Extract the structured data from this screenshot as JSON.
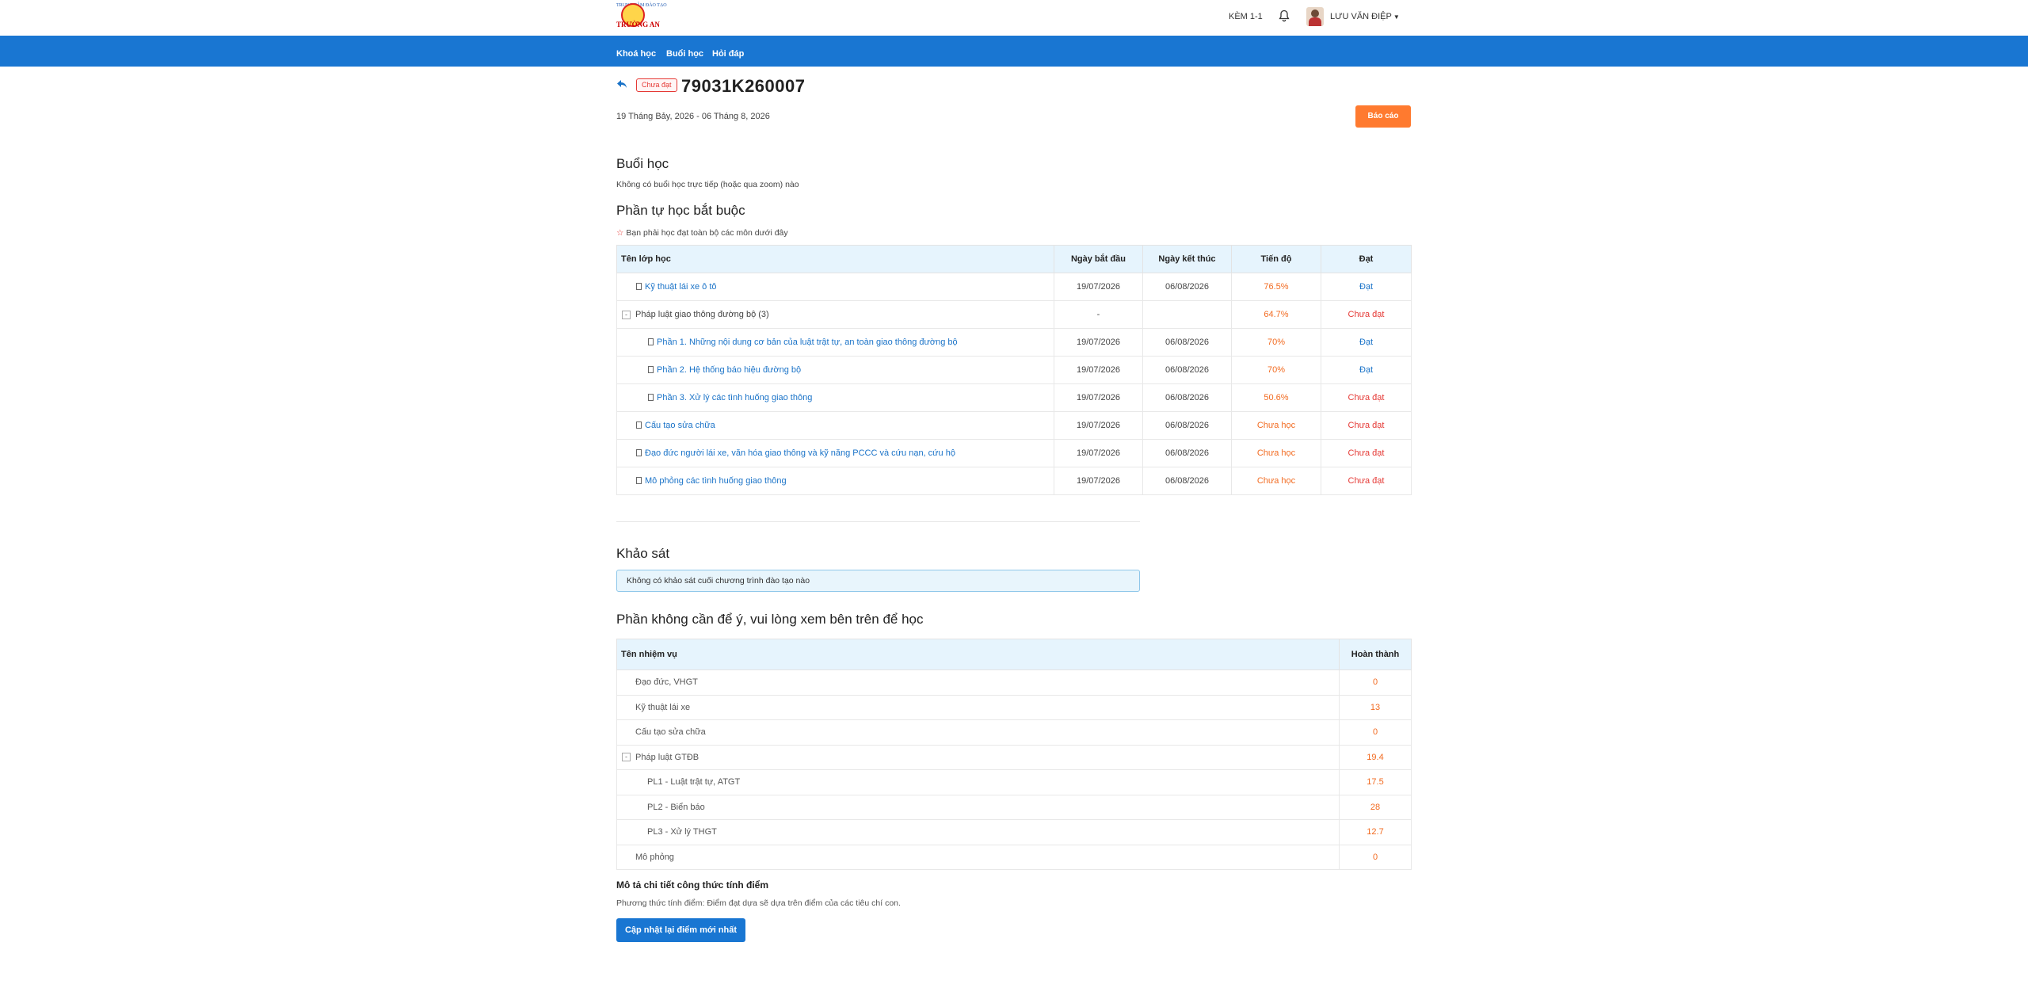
{
  "header": {
    "logo_text": "TRƯỜNG AN",
    "logo_arc_text": "TRUNG TÂM ĐÀO TẠO",
    "kem_label": "KÈM 1-1",
    "user_name": "LƯU VĂN ĐIỆP"
  },
  "nav": {
    "items": [
      "Khoá học",
      "Buổi học",
      "Hỏi đáp"
    ]
  },
  "course": {
    "status_badge": "Chưa đạt",
    "code": "79031K260007",
    "date_range": "19 Tháng Bảy, 2026 - 06 Tháng 8, 2026",
    "report_button": "Báo cáo"
  },
  "sessions": {
    "title": "Buổi học",
    "empty_text": "Không có buổi học trực tiếp (hoặc qua zoom) nào"
  },
  "required": {
    "title": "Phần tự học bắt buộc",
    "note": "Bạn phải học đạt toàn bộ các môn dưới đây",
    "columns": [
      "Tên lớp học",
      "Ngày bắt đầu",
      "Ngày kết thúc",
      "Tiến độ",
      "Đạt"
    ],
    "rows": [
      {
        "name": "Kỹ thuật lái xe ô tô",
        "start": "19/07/2026",
        "end": "06/08/2026",
        "progress": "76.5%",
        "result": "Đạt"
      },
      {
        "name": "Pháp luật giao thông đường bộ",
        "count": "(3)",
        "start": "-",
        "end": "",
        "progress": "64.7%",
        "result": "Chưa đạt"
      },
      {
        "name": "Phần 1. Những nội dung cơ bản của luật trật tự, an toàn giao thông đường bộ",
        "start": "19/07/2026",
        "end": "06/08/2026",
        "progress": "70%",
        "result": "Đạt"
      },
      {
        "name": "Phần 2. Hệ thống báo hiệu đường bộ",
        "start": "19/07/2026",
        "end": "06/08/2026",
        "progress": "70%",
        "result": "Đạt"
      },
      {
        "name": "Phần 3. Xử lý các tình huống giao thông",
        "start": "19/07/2026",
        "end": "06/08/2026",
        "progress": "50.6%",
        "result": "Chưa đạt"
      },
      {
        "name": "Cấu tạo sửa chữa",
        "start": "19/07/2026",
        "end": "06/08/2026",
        "progress": "Chưa học",
        "result": "Chưa đạt"
      },
      {
        "name": "Đạo đức người lái xe, văn hóa giao thông và kỹ năng PCCC và cứu nạn, cứu hộ",
        "start": "19/07/2026",
        "end": "06/08/2026",
        "progress": "Chưa học",
        "result": "Chưa đạt"
      },
      {
        "name": "Mô phỏng các tình huống giao thông",
        "start": "19/07/2026",
        "end": "06/08/2026",
        "progress": "Chưa học",
        "result": "Chưa đạt"
      }
    ]
  },
  "survey": {
    "title": "Khảo sát",
    "empty_text": "Không có khảo sát cuối chương trình đào tạo nào"
  },
  "optional": {
    "title": "Phần không cần để ý, vui lòng xem bên trên để học",
    "columns": [
      "Tên nhiệm vụ",
      "Hoàn thành"
    ],
    "rows": [
      {
        "name": "Đạo đức, VHGT",
        "value": "0"
      },
      {
        "name": "Kỹ thuật lái xe",
        "value": "13"
      },
      {
        "name": "Cấu tạo sửa chữa",
        "value": "0"
      },
      {
        "name": "Pháp luật GTĐB",
        "value": "19.4"
      },
      {
        "name": "PL1 - Luật trật tự, ATGT",
        "value": "17.5"
      },
      {
        "name": "PL2 - Biển báo",
        "value": "28"
      },
      {
        "name": "PL3 - Xử lý THGT",
        "value": "12.7"
      },
      {
        "name": "Mô phỏng",
        "value": "0"
      }
    ]
  },
  "formula": {
    "title": "Mô tả chi tiết công thức tính điểm",
    "text": "Phương thức tính điểm: Điểm đạt dựa sẽ dựa trên điểm của các tiêu chí con.",
    "update_button": "Cập nhật lại điểm mới nhất"
  }
}
